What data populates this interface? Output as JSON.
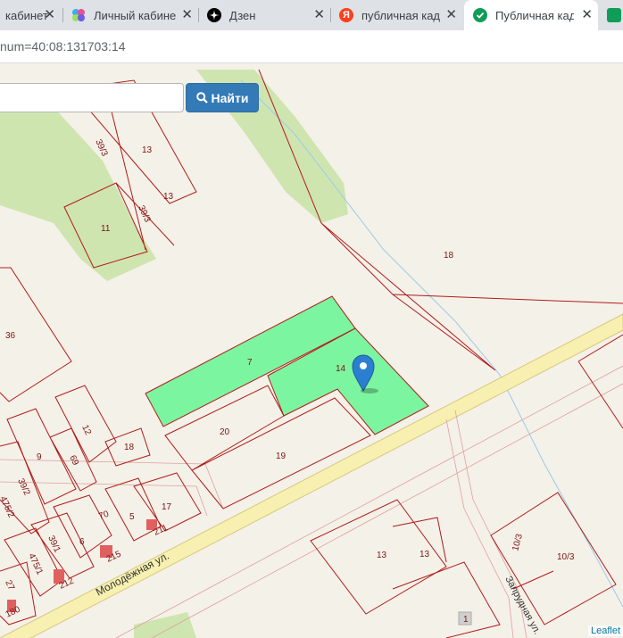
{
  "tabs": [
    {
      "label": "кабинет",
      "icon": "generic-tab-icon",
      "close": "✕"
    },
    {
      "label": "Личный кабинет",
      "icon": "gosuslugi-icon",
      "close": "✕"
    },
    {
      "label": "Дзен",
      "icon": "dzen-icon",
      "close": "✕"
    },
    {
      "label": "публичная када",
      "icon": "yandex-icon",
      "close": "✕"
    },
    {
      "label": "Публичная када",
      "icon": "check-circle-icon",
      "close": "✕"
    }
  ],
  "address_bar": {
    "url": "num=40:08:131703:14"
  },
  "search": {
    "placeholder": "",
    "button_label": "Найти"
  },
  "map": {
    "attribution": "Leaflet",
    "parcel_labels": [
      "39/3",
      "13",
      "13",
      "39/3",
      "11",
      "18",
      "36",
      "7",
      "14",
      "20",
      "19",
      "12",
      "18",
      "69",
      "9",
      "39/2",
      "475/2",
      "70",
      "5",
      "17",
      "39/1",
      "6",
      "215",
      "211",
      "475/1",
      "212",
      "27",
      "180",
      "13",
      "13",
      "10/3",
      "10/3",
      "1"
    ],
    "street_labels": [
      "Молодёжная ул.",
      "Запрудная ул."
    ],
    "colors": {
      "selected_parcel": "#7cf5a0",
      "parcel_border": "#b01c1c",
      "road": "#f7f0b0",
      "pin": "#2b7fd0"
    }
  }
}
